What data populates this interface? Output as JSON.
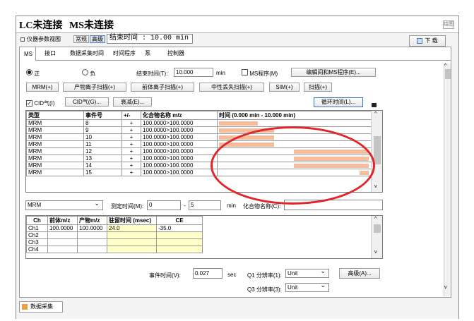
{
  "top_faded_text": "",
  "window": {
    "title_lc": "LC未连接",
    "title_ms": "MS未连接",
    "corner_button": "绘图"
  },
  "subbar": {
    "view_label": "仪器参数视图",
    "normal_btn": "常规",
    "advanced_btn": "高级",
    "end_time_label": "结束时间 : 10.00 min",
    "download_label": "下 载"
  },
  "tabs": [
    "MS",
    "接口",
    "数据采集时间",
    "时间程序",
    "泵",
    "控制器"
  ],
  "polarity": {
    "positive": "正",
    "negative": "负",
    "end_time_label": "结束时间(T):",
    "end_time_value": "10.000",
    "end_time_unit": "min",
    "ms_program_label": "MS程序(M)",
    "edit_button": "编辑间和MS程序(E)..."
  },
  "scan_buttons": [
    "MRM(+)",
    "产物离子扫描(+)",
    "前体离子扫描(+)",
    "中性丢失扫描(+)",
    "SIM(+)",
    "扫描(+)"
  ],
  "cid_row": {
    "cid_label": "CID气(I)",
    "cid_button": "CID气(G)...",
    "decay_button": "衰减(E)...",
    "cycle_button": "循环时间(L)..."
  },
  "event_table": {
    "headers": [
      "类型",
      "事件号",
      "+/-",
      "化合物名称 m/z",
      "时间 (0.000 min - 10.000 min)"
    ],
    "rows": [
      {
        "type": "MRM",
        "event": "8",
        "sign": "+",
        "compound": "100.0000>100.0000",
        "bar": [
          0.0,
          0.26
        ]
      },
      {
        "type": "MRM",
        "event": "9",
        "sign": "+",
        "compound": "100.0000>100.0000",
        "bar": [
          0.0,
          0.37
        ]
      },
      {
        "type": "MRM",
        "event": "10",
        "sign": "+",
        "compound": "100.0000>100.0000",
        "bar": [
          0.0,
          0.37
        ]
      },
      {
        "type": "MRM",
        "event": "11",
        "sign": "+",
        "compound": "100.0000>100.0000",
        "bar": [
          0.0,
          0.37
        ]
      },
      {
        "type": "MRM",
        "event": "12",
        "sign": "+",
        "compound": "100.0000>100.0000",
        "bar": [
          0.5,
          1.0
        ]
      },
      {
        "type": "MRM",
        "event": "13",
        "sign": "+",
        "compound": "100.0000>100.0000",
        "bar": [
          0.5,
          1.0
        ]
      },
      {
        "type": "MRM",
        "event": "14",
        "sign": "+",
        "compound": "100.0000>100.0000",
        "bar": [
          0.5,
          1.0
        ]
      },
      {
        "type": "MRM",
        "event": "15",
        "sign": "+",
        "compound": "100.0000>100.0000",
        "bar": [
          0.94,
          1.0
        ]
      }
    ]
  },
  "detail_row": {
    "type_value": "MRM",
    "measure_time_label": "测定时间(M):",
    "measure_time_from": "0",
    "measure_time_to": "5",
    "measure_time_unit": "min",
    "compound_name_label": "化合物名称(C):",
    "compound_name_value": ""
  },
  "ch_table": {
    "headers": [
      "Ch",
      "前体m/z",
      "产物m/z",
      "驻留时间 (msec)",
      "CE"
    ],
    "rows": [
      [
        "Ch1",
        "100.0000",
        "100.0000",
        "24.0",
        "-35.0"
      ],
      [
        "Ch2",
        "",
        "",
        "",
        ""
      ],
      [
        "Ch3",
        "",
        "",
        "",
        ""
      ],
      [
        "Ch4",
        "",
        "",
        "",
        ""
      ]
    ]
  },
  "bottom_fields": {
    "event_time_label": "事件时间(V):",
    "event_time_value": "0.027",
    "event_time_unit": "sec",
    "q1_label": "Q1 分辨率(1):",
    "q1_value": "Unit",
    "q3_label": "Q3 分辨率(3):",
    "q3_value": "Unit",
    "advanced_button": "高级(A)..."
  },
  "footer": {
    "tab_label": "数据采集"
  },
  "colors": {
    "bar": "#f5bd9b",
    "annotation": "#e0262a",
    "yellow_cell": "#ffffc8"
  }
}
